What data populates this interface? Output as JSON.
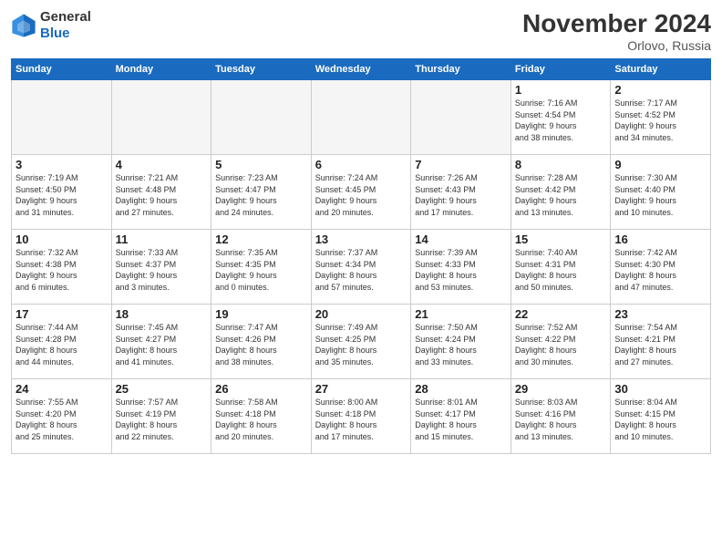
{
  "logo": {
    "general": "General",
    "blue": "Blue"
  },
  "header": {
    "month": "November 2024",
    "location": "Orlovo, Russia"
  },
  "weekdays": [
    "Sunday",
    "Monday",
    "Tuesday",
    "Wednesday",
    "Thursday",
    "Friday",
    "Saturday"
  ],
  "weeks": [
    [
      {
        "day": "",
        "info": ""
      },
      {
        "day": "",
        "info": ""
      },
      {
        "day": "",
        "info": ""
      },
      {
        "day": "",
        "info": ""
      },
      {
        "day": "",
        "info": ""
      },
      {
        "day": "1",
        "info": "Sunrise: 7:16 AM\nSunset: 4:54 PM\nDaylight: 9 hours\nand 38 minutes."
      },
      {
        "day": "2",
        "info": "Sunrise: 7:17 AM\nSunset: 4:52 PM\nDaylight: 9 hours\nand 34 minutes."
      }
    ],
    [
      {
        "day": "3",
        "info": "Sunrise: 7:19 AM\nSunset: 4:50 PM\nDaylight: 9 hours\nand 31 minutes."
      },
      {
        "day": "4",
        "info": "Sunrise: 7:21 AM\nSunset: 4:48 PM\nDaylight: 9 hours\nand 27 minutes."
      },
      {
        "day": "5",
        "info": "Sunrise: 7:23 AM\nSunset: 4:47 PM\nDaylight: 9 hours\nand 24 minutes."
      },
      {
        "day": "6",
        "info": "Sunrise: 7:24 AM\nSunset: 4:45 PM\nDaylight: 9 hours\nand 20 minutes."
      },
      {
        "day": "7",
        "info": "Sunrise: 7:26 AM\nSunset: 4:43 PM\nDaylight: 9 hours\nand 17 minutes."
      },
      {
        "day": "8",
        "info": "Sunrise: 7:28 AM\nSunset: 4:42 PM\nDaylight: 9 hours\nand 13 minutes."
      },
      {
        "day": "9",
        "info": "Sunrise: 7:30 AM\nSunset: 4:40 PM\nDaylight: 9 hours\nand 10 minutes."
      }
    ],
    [
      {
        "day": "10",
        "info": "Sunrise: 7:32 AM\nSunset: 4:38 PM\nDaylight: 9 hours\nand 6 minutes."
      },
      {
        "day": "11",
        "info": "Sunrise: 7:33 AM\nSunset: 4:37 PM\nDaylight: 9 hours\nand 3 minutes."
      },
      {
        "day": "12",
        "info": "Sunrise: 7:35 AM\nSunset: 4:35 PM\nDaylight: 9 hours\nand 0 minutes."
      },
      {
        "day": "13",
        "info": "Sunrise: 7:37 AM\nSunset: 4:34 PM\nDaylight: 8 hours\nand 57 minutes."
      },
      {
        "day": "14",
        "info": "Sunrise: 7:39 AM\nSunset: 4:33 PM\nDaylight: 8 hours\nand 53 minutes."
      },
      {
        "day": "15",
        "info": "Sunrise: 7:40 AM\nSunset: 4:31 PM\nDaylight: 8 hours\nand 50 minutes."
      },
      {
        "day": "16",
        "info": "Sunrise: 7:42 AM\nSunset: 4:30 PM\nDaylight: 8 hours\nand 47 minutes."
      }
    ],
    [
      {
        "day": "17",
        "info": "Sunrise: 7:44 AM\nSunset: 4:28 PM\nDaylight: 8 hours\nand 44 minutes."
      },
      {
        "day": "18",
        "info": "Sunrise: 7:45 AM\nSunset: 4:27 PM\nDaylight: 8 hours\nand 41 minutes."
      },
      {
        "day": "19",
        "info": "Sunrise: 7:47 AM\nSunset: 4:26 PM\nDaylight: 8 hours\nand 38 minutes."
      },
      {
        "day": "20",
        "info": "Sunrise: 7:49 AM\nSunset: 4:25 PM\nDaylight: 8 hours\nand 35 minutes."
      },
      {
        "day": "21",
        "info": "Sunrise: 7:50 AM\nSunset: 4:24 PM\nDaylight: 8 hours\nand 33 minutes."
      },
      {
        "day": "22",
        "info": "Sunrise: 7:52 AM\nSunset: 4:22 PM\nDaylight: 8 hours\nand 30 minutes."
      },
      {
        "day": "23",
        "info": "Sunrise: 7:54 AM\nSunset: 4:21 PM\nDaylight: 8 hours\nand 27 minutes."
      }
    ],
    [
      {
        "day": "24",
        "info": "Sunrise: 7:55 AM\nSunset: 4:20 PM\nDaylight: 8 hours\nand 25 minutes."
      },
      {
        "day": "25",
        "info": "Sunrise: 7:57 AM\nSunset: 4:19 PM\nDaylight: 8 hours\nand 22 minutes."
      },
      {
        "day": "26",
        "info": "Sunrise: 7:58 AM\nSunset: 4:18 PM\nDaylight: 8 hours\nand 20 minutes."
      },
      {
        "day": "27",
        "info": "Sunrise: 8:00 AM\nSunset: 4:18 PM\nDaylight: 8 hours\nand 17 minutes."
      },
      {
        "day": "28",
        "info": "Sunrise: 8:01 AM\nSunset: 4:17 PM\nDaylight: 8 hours\nand 15 minutes."
      },
      {
        "day": "29",
        "info": "Sunrise: 8:03 AM\nSunset: 4:16 PM\nDaylight: 8 hours\nand 13 minutes."
      },
      {
        "day": "30",
        "info": "Sunrise: 8:04 AM\nSunset: 4:15 PM\nDaylight: 8 hours\nand 10 minutes."
      }
    ]
  ]
}
